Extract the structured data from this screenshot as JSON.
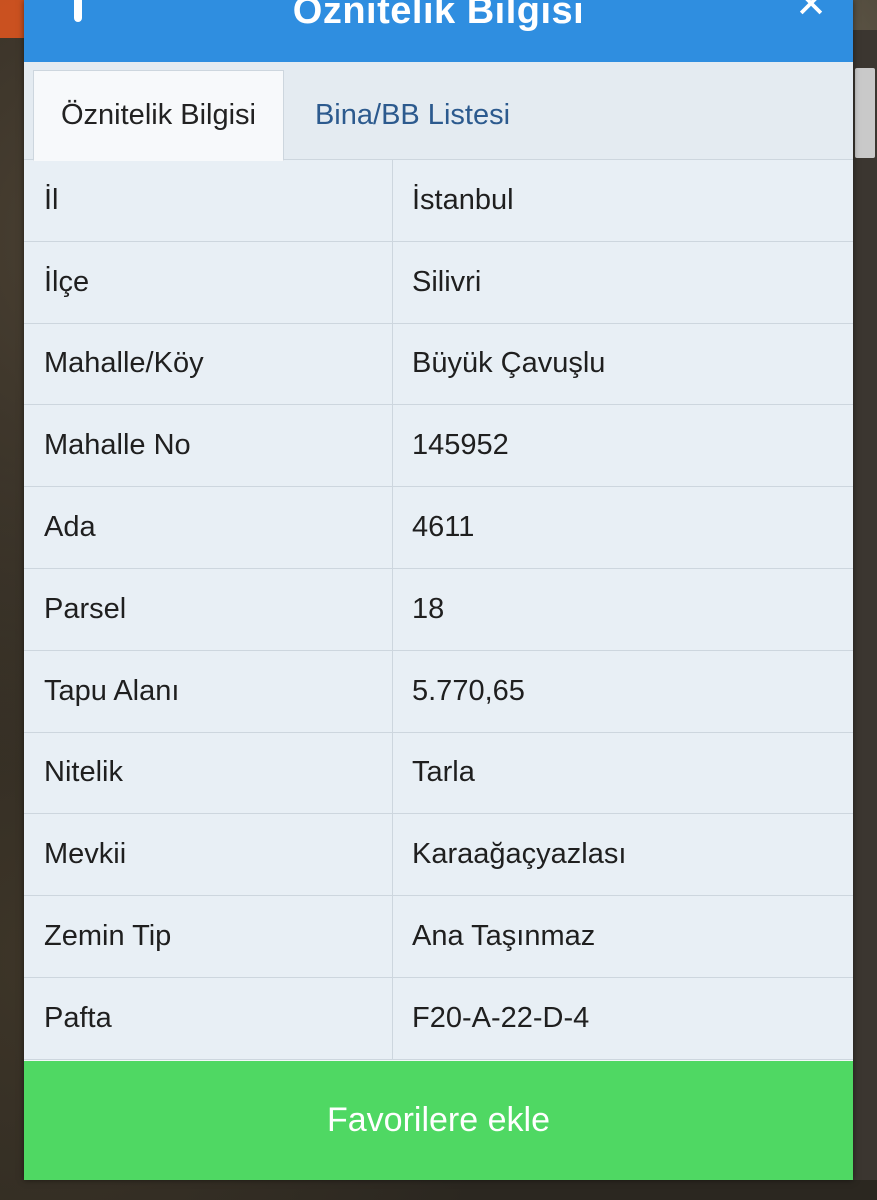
{
  "dialog": {
    "title": "Öznitelik Bilgisi"
  },
  "tabs": [
    {
      "label": "Öznitelik Bilgisi",
      "active": true
    },
    {
      "label": "Bina/BB Listesi",
      "active": false
    }
  ],
  "rows": [
    {
      "label": "İl",
      "value": "İstanbul"
    },
    {
      "label": "İlçe",
      "value": "Silivri"
    },
    {
      "label": "Mahalle/Köy",
      "value": "Büyük Çavuşlu"
    },
    {
      "label": "Mahalle No",
      "value": "145952"
    },
    {
      "label": "Ada",
      "value": "4611"
    },
    {
      "label": "Parsel",
      "value": "18"
    },
    {
      "label": "Tapu Alanı",
      "value": "5.770,65"
    },
    {
      "label": "Nitelik",
      "value": "Tarla"
    },
    {
      "label": "Mevkii",
      "value": "Karaağaçyazlası"
    },
    {
      "label": "Zemin Tip",
      "value": "Ana Taşınmaz"
    },
    {
      "label": "Pafta",
      "value": "F20-A-22-D-4"
    }
  ],
  "favorite_button": {
    "label": "Favorilere ekle"
  },
  "colors": {
    "header": "#2f8ee0",
    "button": "#4fd863",
    "tab_inactive_text": "#2c5a8e"
  }
}
